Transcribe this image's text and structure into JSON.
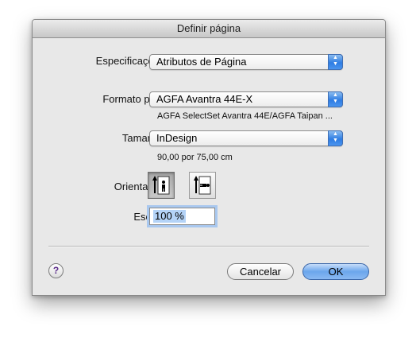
{
  "window": {
    "title": "Definir página"
  },
  "specifications": {
    "label": "Especificações:",
    "value": "Atributos de Página"
  },
  "format_for": {
    "label": "Formato para:",
    "value": "AGFA Avantra 44E-X",
    "description": "AGFA SelectSet Avantra 44E/AGFA Taipan ..."
  },
  "size": {
    "label": "Tamanho:",
    "value": "InDesign",
    "dimensions": "90,00 por 75,00 cm"
  },
  "orientation": {
    "label": "Orientação:",
    "selected": "portrait",
    "portrait_icon": "portrait-orientation-icon",
    "landscape_icon": "landscape-orientation-icon"
  },
  "scale": {
    "label": "Escala:",
    "value": "100 %"
  },
  "buttons": {
    "help": "?",
    "cancel": "Cancelar",
    "ok": "OK"
  },
  "colors": {
    "accent": "#3f84e5",
    "focus_ring": "#a9c8ef",
    "selection": "#b4d3f7"
  }
}
